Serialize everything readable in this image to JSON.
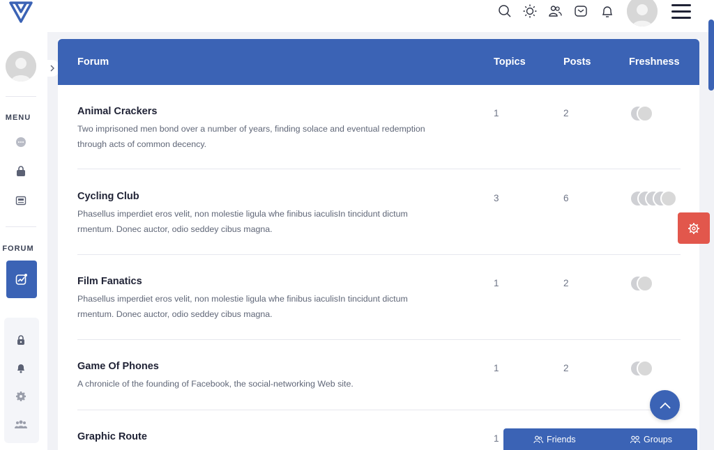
{
  "header": {
    "icons": [
      "search-icon",
      "sun-icon",
      "users-icon",
      "mail-icon",
      "bell-icon"
    ]
  },
  "sidebar": {
    "menu_heading": "MENU",
    "forum_heading": "FORUM",
    "menu_icons": [
      "chat-icon",
      "bag-icon",
      "news-icon"
    ],
    "lower_icons": [
      "lock-icon",
      "bell-icon",
      "gear-icon",
      "group-icon"
    ]
  },
  "forum": {
    "columns": {
      "forum": "Forum",
      "topics": "Topics",
      "posts": "Posts",
      "freshness": "Freshness"
    },
    "rows": [
      {
        "title": "Animal Crackers",
        "desc1": "Two imprisoned men bond over a number of years, finding solace and eventual redemption",
        "desc2": "through acts of common decency.",
        "topics": "1",
        "posts": "2"
      },
      {
        "title": "Cycling Club",
        "desc1": "Phasellus imperdiet eros velit, non molestie ligula whe finibus iaculisIn tincidunt dictum",
        "desc2": "rmentum. Donec auctor, odio seddey cibus magna.",
        "topics": "3",
        "posts": "6"
      },
      {
        "title": "Film Fanatics",
        "desc1": "Phasellus imperdiet eros velit, non molestie ligula whe finibus iaculisIn tincidunt dictum",
        "desc2": "rmentum. Donec auctor, odio seddey cibus magna.",
        "topics": "1",
        "posts": "2"
      },
      {
        "title": "Game Of Phones",
        "desc1": "A chronicle of the founding of Facebook, the social-networking Web site.",
        "desc2": "",
        "topics": "1",
        "posts": "2"
      },
      {
        "title": "Graphic Route",
        "desc1": "",
        "desc2": "",
        "topics": "1",
        "posts": ""
      }
    ]
  },
  "bottom_bar": {
    "friends": "Friends",
    "groups": "Groups"
  },
  "colors": {
    "primary": "#3b63b5",
    "settings": "#e2574c",
    "text": "#1f2235",
    "muted": "#5f6677"
  }
}
